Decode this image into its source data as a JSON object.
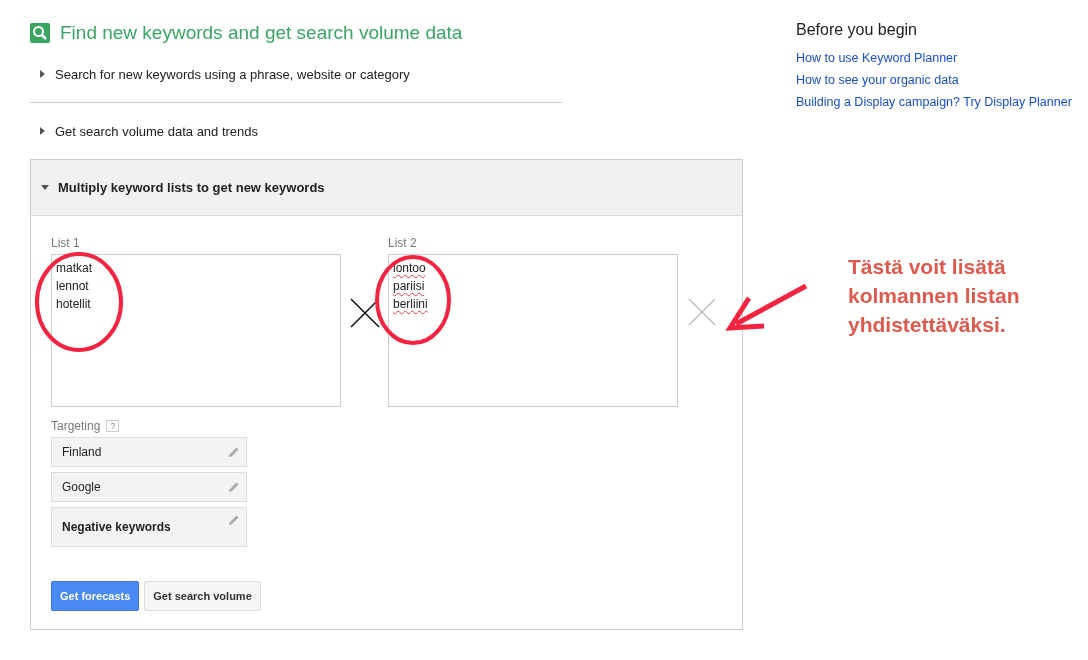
{
  "title": "Find new keywords and get search volume data",
  "sections": [
    {
      "label": "Search for new keywords using a phrase, website or category",
      "expanded": false
    },
    {
      "label": "Get search volume data and trends",
      "expanded": false
    }
  ],
  "panel": {
    "label": "Multiply keyword lists to get new keywords",
    "expanded": true,
    "lists": [
      {
        "label": "List 1",
        "items": [
          "matkat",
          "lennot",
          "hotellit"
        ],
        "misspelled": false
      },
      {
        "label": "List 2",
        "items": [
          "lontoo",
          "pariisi",
          "berliini"
        ],
        "misspelled": true
      }
    ],
    "targeting": {
      "label": "Targeting",
      "help": "?",
      "items": [
        {
          "label": "Finland",
          "bold": false
        },
        {
          "label": "Google",
          "bold": false
        },
        {
          "label": "Negative keywords",
          "bold": true
        }
      ]
    },
    "buttons": [
      {
        "label": "Get forecasts",
        "kind": "primary"
      },
      {
        "label": "Get search volume",
        "kind": "secondary"
      }
    ]
  },
  "annotation": {
    "text": "Tästä voit lisätä kolmannen listan yhdistettäväksi."
  },
  "sidebar": {
    "heading": "Before you begin",
    "links": [
      "How to use Keyword Planner",
      "How to see your organic data",
      "Building a Display campaign? Try Display Planner"
    ]
  }
}
